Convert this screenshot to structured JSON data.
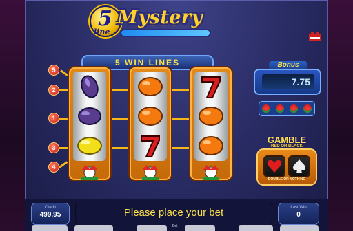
{
  "logo": {
    "number": "5",
    "line_word": "line",
    "title": "Mystery"
  },
  "win_lines_label": "5 WIN LINES",
  "line_badges": [
    "5",
    "2",
    "1",
    "3",
    "4"
  ],
  "reels": [
    {
      "symbols": [
        "plum",
        "plum",
        "lemon"
      ],
      "joker": "joker"
    },
    {
      "symbols": [
        "orange",
        "orange",
        "seven"
      ],
      "joker": "joker"
    },
    {
      "symbols": [
        "seven",
        "orange",
        "orange"
      ],
      "joker": "joker"
    }
  ],
  "bonus": {
    "title": "Bonus",
    "value": "7.75",
    "joker_icons": [
      "joker-icon",
      "joker-icon",
      "joker-icon",
      "joker-icon"
    ]
  },
  "gamble": {
    "title": "GAMBLE",
    "subtitle": "RED OR BLACK",
    "footer": "DOUBLE OR NOTHING",
    "cards": [
      "heart-icon",
      "spade-icon"
    ]
  },
  "credit": {
    "label": "Credit",
    "value": "499.95"
  },
  "message": "Please place your bet",
  "last_win": {
    "label": "Last Win",
    "value": "0"
  },
  "bet_label": "Bet",
  "colors": {
    "accent": "#ffd12a",
    "reel_frame": "#e28a19",
    "payline": "#f5b81a",
    "badge": "#c81e1e",
    "panel_blue": "#2a55c0"
  }
}
